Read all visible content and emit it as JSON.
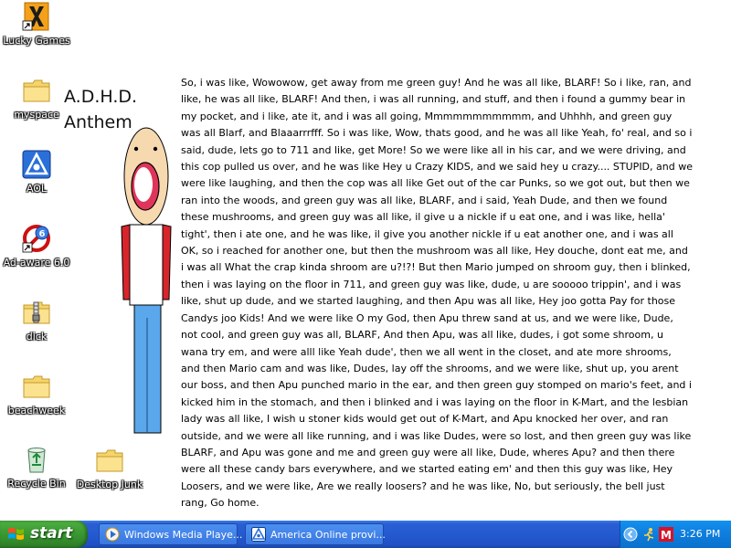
{
  "desktop": {
    "icons": [
      {
        "label": "Lucky Games"
      },
      {
        "label": "myspace"
      },
      {
        "label": "AOL"
      },
      {
        "label": "Ad-aware 6.0"
      },
      {
        "label": "dick"
      },
      {
        "label": "beachweek"
      },
      {
        "label": "Recycle Bin"
      },
      {
        "label": "Desktop Junk"
      }
    ]
  },
  "anthem": {
    "title_line1": "A.D.H.D.",
    "title_line2": "Anthem",
    "body": "So, i was like, Wowowow, get away from me green guy! And he was all like, BLARF! So i like, ran, and like, he was all like, BLARF! And then, i was all running, and stuff, and then i found a gummy bear in my pocket, and i like, ate it, and i was all going, Mmmmmmmmmmm, and Uhhhh, and green guy was all Blarf, and Blaaarrrfff. So i was like, Wow, thats good, and he was all like Yeah, fo' real, and so i said, dude, lets go to 711 and like, get More! So we were like all in his car, and we were driving, and this cop pulled us over, and he was like Hey u Crazy KIDS, and we said hey u crazy.... STUPID, and we were like laughing, and then the cop was all like Get out of the car Punks, so we got out, but then we ran into the woods, and green guy was all like, BLARF, and i said, Yeah Dude, and then we found these mushrooms, and green guy was all like, il give u a nickle if u eat one, and i was like, hella' tight', then i ate one, and he was like, il give you another nickle if u eat another one, and i was all OK, so i reached for another one, but then the mushroom was all like, Hey douche, dont eat me, and i was all What the crap kinda shroom are u?!?!  But then Mario jumped on shroom guy, then i blinked, then i was laying on the floor in 711, and green guy was like, dude, u are sooooo trippin', and i was like, shut up dude, and we started laughing, and then Apu was all like, Hey joo gotta Pay for those Candys joo Kids! And we were like O my God, then Apu threw sand at us, and we were like, Dude, not cool, and green guy was all, BLARF, And then Apu, was all like, dudes, i got some shroom, u wana try em, and were alll like Yeah dude', then we all went in the closet, and ate more shrooms, and then Mario cam and was like, Dudes, lay off the shrooms, and we were like, shut up, you arent our boss, and then Apu punched mario in the ear, and then green guy stomped on mario's feet, and i kicked him in the stomach, and then i blinked and i was laying on the floor in K-Mart, and the lesbian lady was all like, I wish u stoner kids would get out of K-Mart, and Apu knocked her over, and ran outside, and we were all like running, and i was like Dudes, were so lost, and then green guy was like BLARF, and Apu was gone and me and green guy were all like, Dude, wheres Apu? and then there were all these candy bars everywhere, and we started eating em' and then this guy was like, Hey Loosers, and we were like, Are we really loosers? and he was like, No, but seriously, the bell just rang, Go home."
  },
  "taskbar": {
    "start_label": "start",
    "tasks": [
      {
        "label": "Windows Media Playe..."
      },
      {
        "label": "America  Online provi..."
      }
    ],
    "clock": "3:26 PM"
  },
  "colors": {
    "taskbar_blue": "#245ad0",
    "start_green": "#3c9c33",
    "tray_blue": "#0f80e0"
  }
}
